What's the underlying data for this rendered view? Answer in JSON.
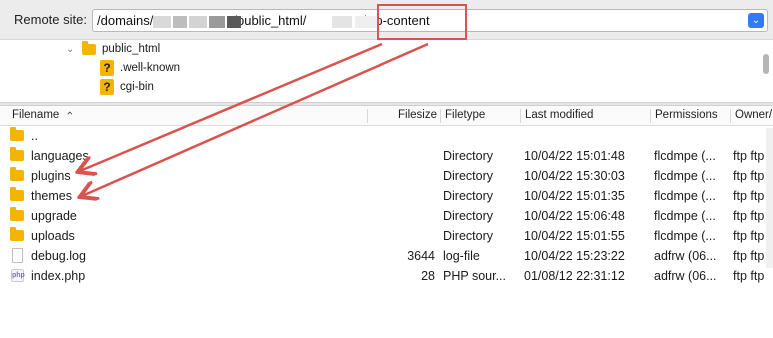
{
  "remote": {
    "label": "Remote site:",
    "path": "/domains/▒▒▒▒▒▒▒/public_html/▒▒▒▒▒▒/wp-content",
    "path_parts": [
      "/domains/",
      "/public_html/",
      "/wp-content"
    ]
  },
  "tree": {
    "items": [
      {
        "label": "public_html",
        "icon": "folder-icon"
      },
      {
        "label": ".well-known",
        "icon": "question-icon"
      },
      {
        "label": "cgi-bin",
        "icon": "question-icon"
      }
    ]
  },
  "columns": {
    "filename": "Filename",
    "filesize": "Filesize",
    "filetype": "Filetype",
    "modified": "Last modified",
    "permissions": "Permissions",
    "owner": "Owner/"
  },
  "files": [
    {
      "name": "..",
      "size": "",
      "type": "",
      "modified": "",
      "perm": "",
      "owner": "",
      "icon": "folder"
    },
    {
      "name": "languages",
      "size": "",
      "type": "Directory",
      "modified": "10/04/22 15:01:48",
      "perm": "flcdmpe (...",
      "owner": "ftp ftp",
      "icon": "folder"
    },
    {
      "name": "plugins",
      "size": "",
      "type": "Directory",
      "modified": "10/04/22 15:30:03",
      "perm": "flcdmpe (...",
      "owner": "ftp ftp",
      "icon": "folder"
    },
    {
      "name": "themes",
      "size": "",
      "type": "Directory",
      "modified": "10/04/22 15:01:35",
      "perm": "flcdmpe (...",
      "owner": "ftp ftp",
      "icon": "folder"
    },
    {
      "name": "upgrade",
      "size": "",
      "type": "Directory",
      "modified": "10/04/22 15:06:48",
      "perm": "flcdmpe (...",
      "owner": "ftp ftp",
      "icon": "folder"
    },
    {
      "name": "uploads",
      "size": "",
      "type": "Directory",
      "modified": "10/04/22 15:01:55",
      "perm": "flcdmpe (...",
      "owner": "ftp ftp",
      "icon": "folder"
    },
    {
      "name": "debug.log",
      "size": "3644",
      "type": "log-file",
      "modified": "10/04/22 15:23:22",
      "perm": "adfrw (06...",
      "owner": "ftp ftp",
      "icon": "file"
    },
    {
      "name": "index.php",
      "size": "28",
      "type": "PHP sour...",
      "modified": "01/08/12 22:31:12",
      "perm": "adfrw (06...",
      "owner": "ftp ftp",
      "icon": "php"
    }
  ],
  "colors": {
    "accent": "#2f7cf6",
    "annotation": "#d9534f",
    "folder": "#f4b400"
  }
}
